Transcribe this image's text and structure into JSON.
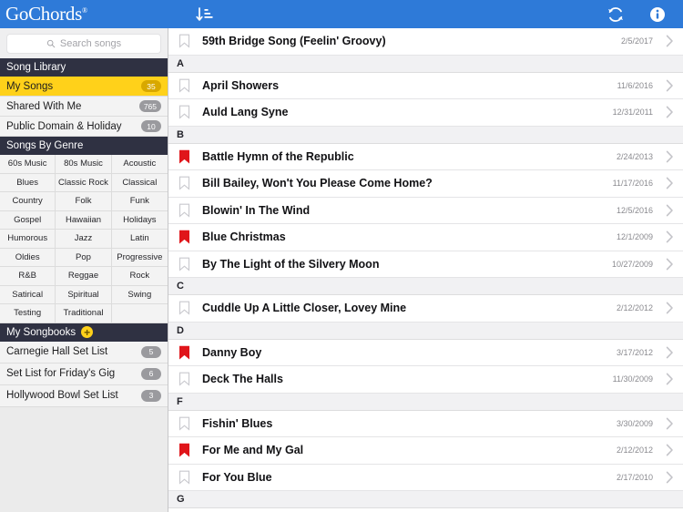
{
  "app": {
    "name": "GoChords",
    "logo_mark": "treble-clef",
    "registered_symbol": "®"
  },
  "colors": {
    "brand_blue": "#2E7AD8",
    "sidebar_header": "#2F3142",
    "selected_yellow": "#FFD11A",
    "badge_gray": "#9A9A9E",
    "favorite_red": "#E0151A",
    "section_header_bg": "#F1F1F3"
  },
  "toolbar": {
    "sort_icon": "sort-ascending-icon",
    "refresh_icon": "refresh-icon",
    "info_icon": "info-icon"
  },
  "search": {
    "placeholder": "Search songs",
    "value": "",
    "icon": "search-icon"
  },
  "sidebar": {
    "library_header": "Song Library",
    "library_items": [
      {
        "label": "My Songs",
        "count": "35",
        "selected": true
      },
      {
        "label": "Shared With Me",
        "count": "765",
        "selected": false
      },
      {
        "label": "Public Domain & Holiday",
        "count": "10",
        "selected": false
      }
    ],
    "genre_header": "Songs By Genre",
    "genres": [
      "60s Music",
      "80s Music",
      "Acoustic",
      "Blues",
      "Classic Rock",
      "Classical",
      "Country",
      "Folk",
      "Funk",
      "Gospel",
      "Hawaiian",
      "Holidays",
      "Humorous",
      "Jazz",
      "Latin",
      "Oldies",
      "Pop",
      "Progressive",
      "R&B",
      "Reggae",
      "Rock",
      "Satirical",
      "Spiritual",
      "Swing",
      "Testing",
      "Traditional",
      ""
    ],
    "songbooks_header": "My Songbooks",
    "songbooks_add_icon": "plus-circle-icon",
    "songbooks": [
      {
        "label": "Carnegie Hall Set List",
        "count": "5"
      },
      {
        "label": "Set List for Friday's Gig",
        "count": "6"
      },
      {
        "label": "Hollywood Bowl Set List",
        "count": "3"
      }
    ]
  },
  "songlist": {
    "entries": [
      {
        "kind": "song",
        "title": "59th Bridge Song (Feelin' Groovy)",
        "date": "2/5/2017",
        "favorite": false
      },
      {
        "kind": "header",
        "letter": "A"
      },
      {
        "kind": "song",
        "title": "April Showers",
        "date": "11/6/2016",
        "favorite": false
      },
      {
        "kind": "song",
        "title": "Auld Lang Syne",
        "date": "12/31/2011",
        "favorite": false
      },
      {
        "kind": "header",
        "letter": "B"
      },
      {
        "kind": "song",
        "title": "Battle Hymn of the Republic",
        "date": "2/24/2013",
        "favorite": true
      },
      {
        "kind": "song",
        "title": "Bill Bailey, Won't You Please Come Home?",
        "date": "11/17/2016",
        "favorite": false
      },
      {
        "kind": "song",
        "title": "Blowin' In The Wind",
        "date": "12/5/2016",
        "favorite": false
      },
      {
        "kind": "song",
        "title": "Blue Christmas",
        "date": "12/1/2009",
        "favorite": true
      },
      {
        "kind": "song",
        "title": "By The Light of the Silvery Moon",
        "date": "10/27/2009",
        "favorite": false
      },
      {
        "kind": "header",
        "letter": "C"
      },
      {
        "kind": "song",
        "title": "Cuddle Up A Little Closer, Lovey Mine",
        "date": "2/12/2012",
        "favorite": false
      },
      {
        "kind": "header",
        "letter": "D"
      },
      {
        "kind": "song",
        "title": "Danny Boy",
        "date": "3/17/2012",
        "favorite": true
      },
      {
        "kind": "song",
        "title": "Deck The Halls",
        "date": "11/30/2009",
        "favorite": false
      },
      {
        "kind": "header",
        "letter": "F"
      },
      {
        "kind": "song",
        "title": "Fishin' Blues",
        "date": "3/30/2009",
        "favorite": false
      },
      {
        "kind": "song",
        "title": "For Me and My Gal",
        "date": "2/12/2012",
        "favorite": true
      },
      {
        "kind": "song",
        "title": "For You Blue",
        "date": "2/17/2010",
        "favorite": false
      },
      {
        "kind": "header",
        "letter": "G"
      }
    ]
  }
}
